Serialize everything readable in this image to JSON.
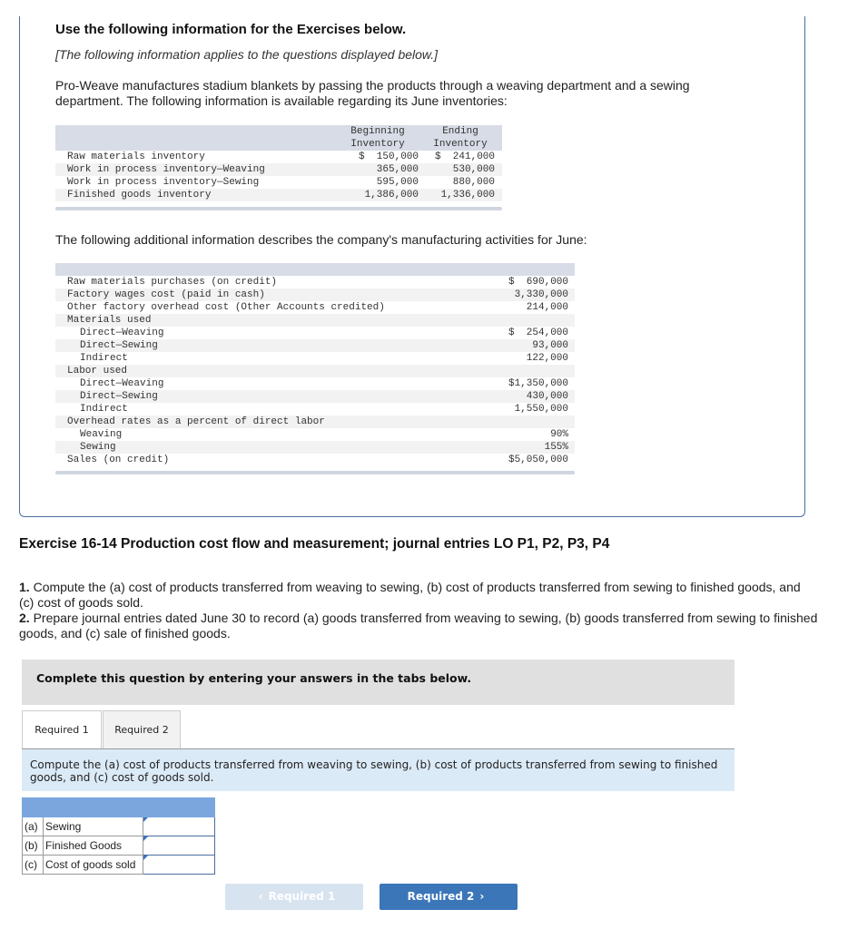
{
  "intro": {
    "heading": "Use the following information for the Exercises below.",
    "note": "[The following information applies to the questions displayed below.]",
    "paragraph": "Pro-Weave manufactures stadium blankets by passing the products through a weaving department and a sewing department. The following information is available regarding its June inventories:"
  },
  "inventory_table": {
    "headers": {
      "beginning_1": "Beginning",
      "beginning_2": "Inventory",
      "ending_1": "Ending",
      "ending_2": "Inventory"
    },
    "rows": [
      {
        "label": "Raw materials inventory",
        "beginning": "$  150,000",
        "ending": "$  241,000"
      },
      {
        "label": "Work in process inventory—Weaving",
        "beginning": "365,000",
        "ending": "530,000"
      },
      {
        "label": "Work in process inventory—Sewing",
        "beginning": "595,000",
        "ending": "880,000"
      },
      {
        "label": "Finished goods inventory",
        "beginning": "1,386,000",
        "ending": "1,336,000"
      }
    ]
  },
  "additional_text": "The following additional information describes the company's manufacturing activities for June:",
  "activities_table": {
    "rows": [
      {
        "label": "Raw materials purchases (on credit)",
        "value": "$  690,000",
        "indent": false
      },
      {
        "label": "Factory wages cost (paid in cash)",
        "value": "3,330,000",
        "indent": false
      },
      {
        "label": "Other factory overhead cost (Other Accounts credited)",
        "value": "214,000",
        "indent": false
      },
      {
        "label": "Materials used",
        "value": "",
        "indent": false
      },
      {
        "label": "Direct—Weaving",
        "value": "$  254,000",
        "indent": true
      },
      {
        "label": "Direct—Sewing",
        "value": "93,000",
        "indent": true
      },
      {
        "label": "Indirect",
        "value": "122,000",
        "indent": true
      },
      {
        "label": "Labor used",
        "value": "",
        "indent": false
      },
      {
        "label": "Direct—Weaving",
        "value": "$1,350,000",
        "indent": true
      },
      {
        "label": "Direct—Sewing",
        "value": "430,000",
        "indent": true
      },
      {
        "label": "Indirect",
        "value": "1,550,000",
        "indent": true
      },
      {
        "label": "Overhead rates as a percent of direct labor",
        "value": "",
        "indent": false
      },
      {
        "label": "Weaving",
        "value": "90%",
        "indent": true
      },
      {
        "label": "Sewing",
        "value": "155%",
        "indent": true
      },
      {
        "label": "Sales (on credit)",
        "value": "$5,050,000",
        "indent": false
      }
    ]
  },
  "exercise": {
    "title": "Exercise 16-14 Production cost flow and measurement; journal entries LO P1, P2, P3, P4",
    "q1_num": "1.",
    "q1_text": " Compute the (a) cost of products transferred from weaving to sewing, (b) cost of products transferred from sewing to finished goods, and (c) cost of goods sold.",
    "q2_num": "2.",
    "q2_text": " Prepare journal entries dated June 30 to record (a) goods transferred from weaving to sewing, (b) goods transferred from sewing to finished goods, and (c) sale of finished goods."
  },
  "complete_banner": "Complete this question by entering your answers in the tabs below.",
  "tabs": [
    {
      "label": "Required 1",
      "active": true
    },
    {
      "label": "Required 2",
      "active": false
    }
  ],
  "instructions": "Compute the (a) cost of products transferred from weaving to sewing, (b) cost of products transferred from sewing to finished goods, and (c) cost of goods sold.",
  "answer_table": {
    "rows": [
      {
        "key": "(a)",
        "label": "Sewing",
        "value": ""
      },
      {
        "key": "(b)",
        "label": "Finished Goods",
        "value": ""
      },
      {
        "key": "(c)",
        "label": "Cost of goods sold",
        "value": ""
      }
    ]
  },
  "nav": {
    "prev_label": "Required 1",
    "next_label": "Required 2",
    "prev_icon": "chevron-left-icon",
    "next_icon": "chevron-right-icon"
  }
}
